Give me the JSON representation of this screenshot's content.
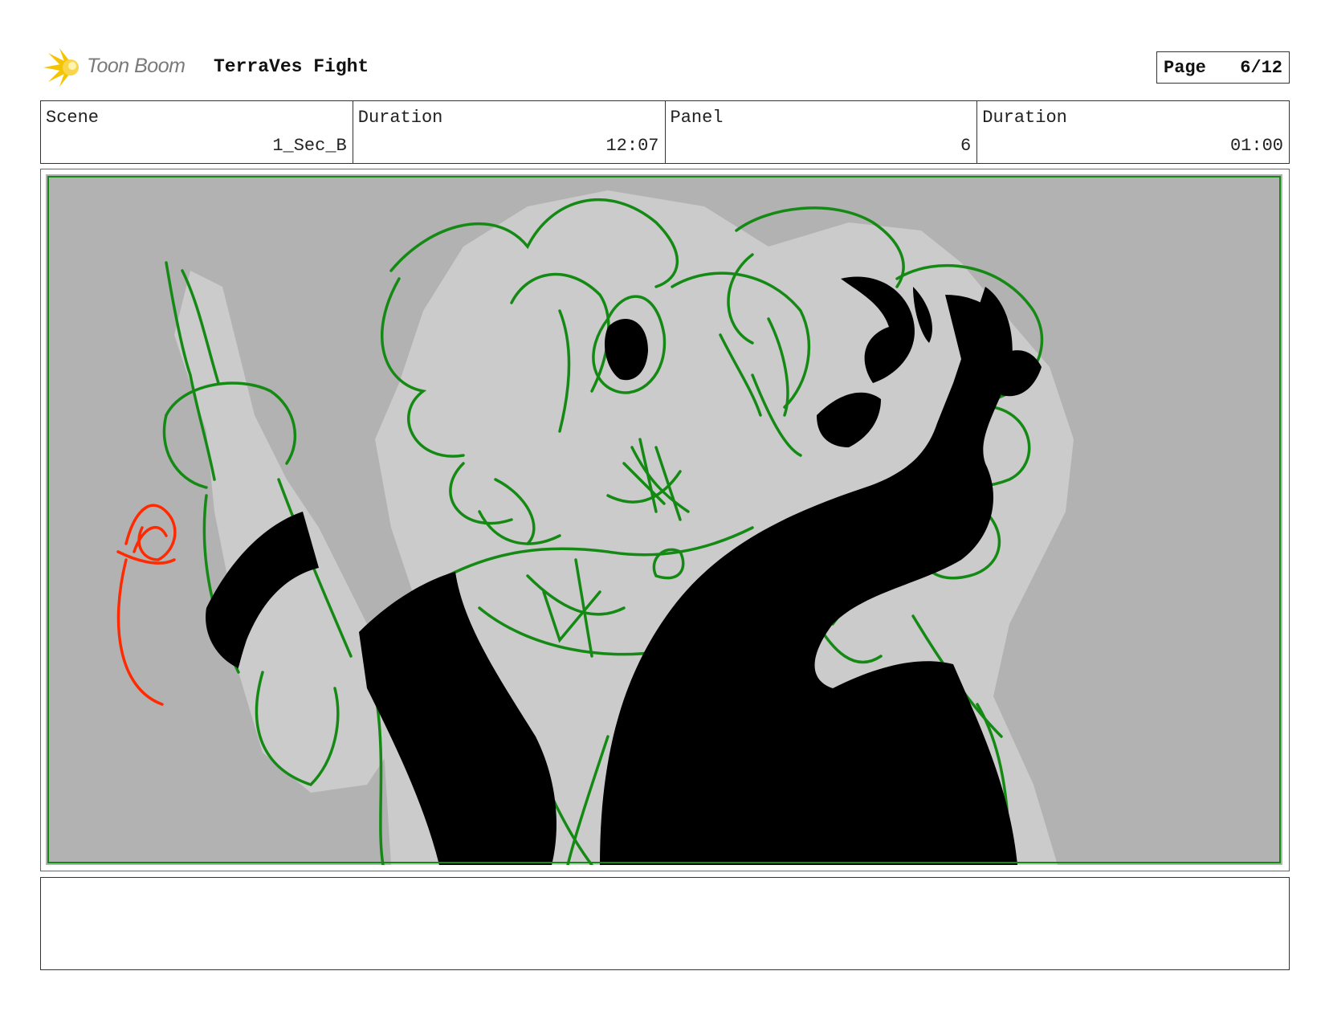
{
  "header": {
    "logo_text": "Toon Boom",
    "project_title": "TerraVes Fight",
    "page_label": "Page",
    "page_number": "6/12"
  },
  "info": {
    "scene_label": "Scene",
    "scene_value": "1_Sec_B",
    "scene_duration_label": "Duration",
    "scene_duration_value": "12:07",
    "panel_label": "Panel",
    "panel_value": "6",
    "panel_duration_label": "Duration",
    "panel_duration_value": "01:00"
  },
  "colors": {
    "background_gray": "#b2b2b2",
    "figure_gray": "#cbcbcb",
    "sketch_green": "#148a14",
    "fill_black": "#000000",
    "annotation_red": "#ff2a00",
    "logo_yellow": "#f5c400"
  },
  "icons": {
    "logo": "toon-boom-starburst-icon"
  }
}
